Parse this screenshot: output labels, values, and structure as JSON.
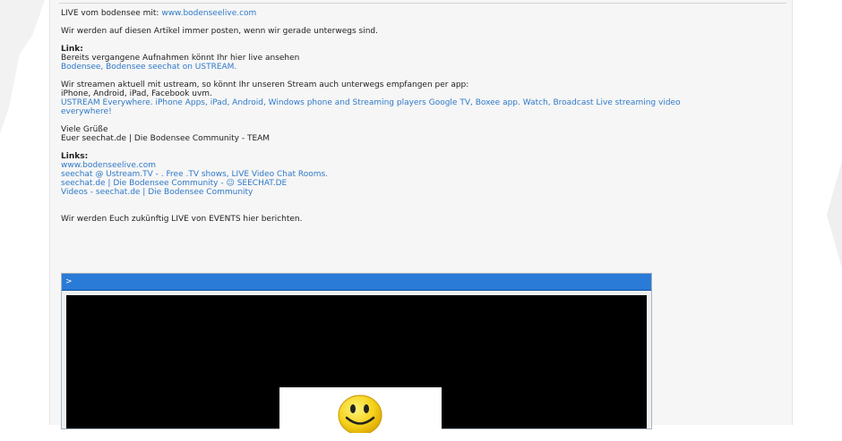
{
  "intro": {
    "prefix": "LIVE vom bodensee mit: ",
    "link": "www.bodenseelive.com"
  },
  "posting_note": "Wir werden auf diesen Artikel immer posten, wenn wir gerade unterwegs sind.",
  "link_section": {
    "heading": "Link:",
    "text": "Bereits vergangene Aufnahmen könnt Ihr hier live ansehen",
    "link": "Bodensee, Bodensee seechat on USTREAM."
  },
  "stream_section": {
    "line1": "Wir streamen aktuell mit ustream, so könnt Ihr unseren Stream auch unterwegs empfangen per app:",
    "line2": "iPhone, Android, iPad, Facebook uvm.",
    "link_line1": "USTREAM Everywhere. iPhone Apps, iPad, Android, Windows phone and Streaming players Google TV, Boxee app. Watch, Broadcast Live streaming video",
    "link_line2": "everywhere!"
  },
  "greeting": {
    "line1": "Viele Grüße",
    "line2": "Euer seechat.de | Die Bodensee Community - TEAM"
  },
  "links_section": {
    "heading": "Links:",
    "items": [
      "www.bodenseelive.com",
      "seechat @ Ustream.TV - . Free .TV shows, LIVE Video Chat Rooms.",
      "seechat.de | Die Bodensee Community - ☺ SEECHAT.DE",
      "Videos - seechat.de | Die Bodensee Community"
    ]
  },
  "events_note": "Wir werden Euch zukünftig LIVE von EVENTS hier berichten.",
  "player": {
    "bar_label": ">"
  },
  "colors": {
    "link": "#2f79c8",
    "player_bar": "#2a7ad8",
    "smiley": "#f5d21a"
  }
}
